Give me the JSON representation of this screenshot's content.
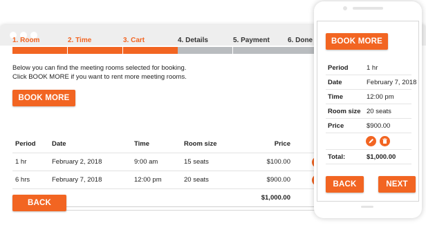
{
  "colors": {
    "accent": "#f26522",
    "pending": "#b9bcbf"
  },
  "steps": [
    {
      "label": "1. Room",
      "state": "done"
    },
    {
      "label": "2. Time",
      "state": "done"
    },
    {
      "label": "3. Cart",
      "state": "current"
    },
    {
      "label": "4. Details",
      "state": "pending"
    },
    {
      "label": "5. Payment",
      "state": "pending"
    },
    {
      "label": "6. Done",
      "state": "pending"
    }
  ],
  "intro": {
    "line1": "Below you can find the meeting rooms selected for booking.",
    "line2": "Click BOOK MORE if you want to rent more meeting rooms."
  },
  "buttons": {
    "book_more": "BOOK MORE",
    "back": "BACK",
    "next": "NEXT"
  },
  "table": {
    "headers": {
      "period": "Period",
      "date": "Date",
      "time": "Time",
      "room_size": "Room size",
      "price": "Price"
    },
    "rows": [
      {
        "period": "1 hr",
        "date": "February 2, 2018",
        "time": "9:00 am",
        "room_size": "15 seats",
        "price": "$100.00"
      },
      {
        "period": "6 hrs",
        "date": "February 7, 2018",
        "time": "12:00 pm",
        "room_size": "20 seats",
        "price": "$900.00"
      }
    ],
    "total_label": "Total:",
    "total_value": "$1,000.00"
  },
  "mobile": {
    "labels": {
      "period": "Period",
      "date": "Date",
      "time": "Time",
      "room_size": "Room size",
      "price": "Price",
      "total": "Total:"
    },
    "item": {
      "period": "1 hr",
      "date": "February 7, 2018",
      "time": "12:00 pm",
      "room_size": "20 seats",
      "price": "$900.00"
    },
    "total_value": "$1,000.00",
    "icons": {
      "edit": "pencil-icon",
      "delete": "trash-icon"
    }
  }
}
